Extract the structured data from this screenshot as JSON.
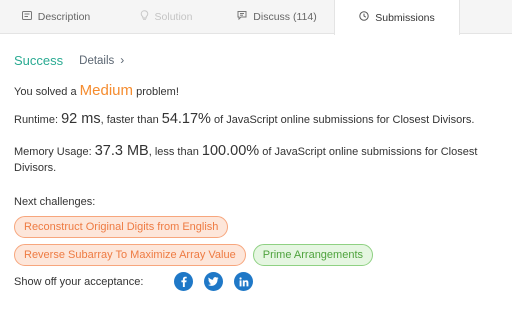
{
  "tabs": [
    {
      "label": "Description",
      "icon": "description-icon"
    },
    {
      "label": "Solution",
      "icon": "solution-icon"
    },
    {
      "label": "Discuss (114)",
      "icon": "discuss-icon"
    },
    {
      "label": "Submissions",
      "icon": "submissions-icon"
    }
  ],
  "result": {
    "status": "Success",
    "details_label": "Details"
  },
  "solved": {
    "prefix": "You solved a",
    "difficulty": "Medium",
    "suffix": "problem!"
  },
  "runtime": {
    "label": "Runtime:",
    "value": "92 ms",
    "middle": ", faster than",
    "percent": "54.17%",
    "suffix": "of JavaScript online submissions for Closest Divisors."
  },
  "memory": {
    "label": "Memory Usage:",
    "value": "37.3 MB",
    "middle": ", less than",
    "percent": "100.00%",
    "suffix": "of JavaScript online submissions for Closest Divisors."
  },
  "next_challenges": {
    "label": "Next challenges:",
    "items": [
      {
        "label": "Reconstruct Original Digits from English",
        "difficulty": "medium"
      },
      {
        "label": "Reverse Subarray To Maximize Array Value",
        "difficulty": "medium"
      },
      {
        "label": "Prime Arrangements",
        "difficulty": "easy"
      }
    ]
  },
  "share": {
    "label": "Show off your acceptance:",
    "networks": [
      "facebook-icon",
      "twitter-icon",
      "linkedin-icon"
    ]
  },
  "colors": {
    "success": "#2aaa92",
    "medium": "#f58c2f",
    "easy": "#4fa33e",
    "social": "#1f78c7"
  }
}
